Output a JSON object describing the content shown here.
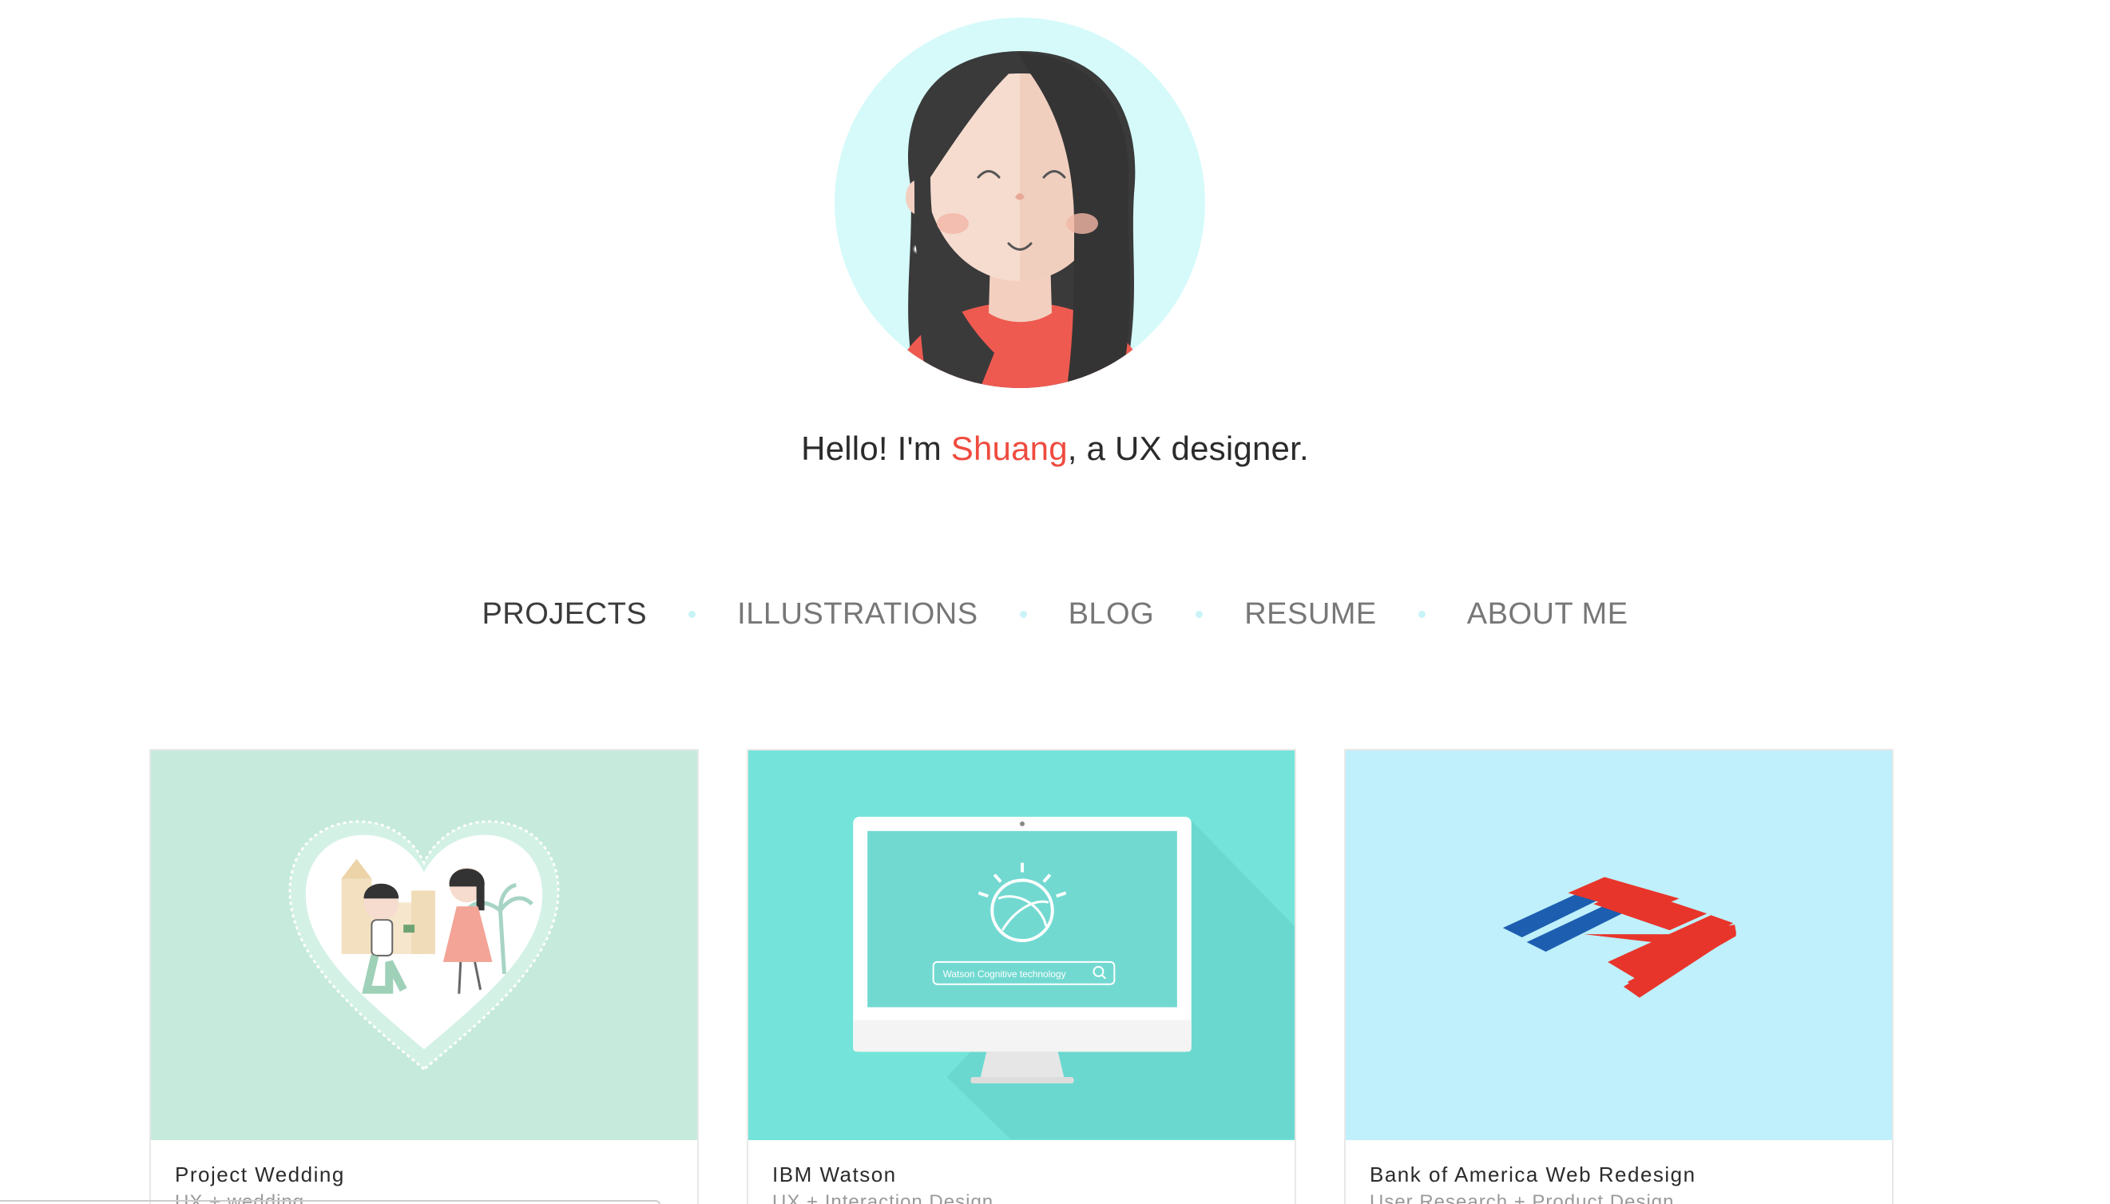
{
  "hero": {
    "greeting_prefix": "Hello! I'm ",
    "name": "Shuang",
    "greeting_suffix": ", a UX designer.",
    "avatar_icon": "girl-avatar-icon"
  },
  "nav": {
    "items": [
      {
        "label": "PROJECTS",
        "active": true
      },
      {
        "label": "ILLUSTRATIONS",
        "active": false
      },
      {
        "label": "BLOG",
        "active": false
      },
      {
        "label": "RESUME",
        "active": false
      },
      {
        "label": "ABOUT ME",
        "active": false
      }
    ]
  },
  "projects": [
    {
      "title": "Project Wedding",
      "subtitle": "UX + wedding",
      "bg": "#c6eadc"
    },
    {
      "title": "IBM Watson",
      "subtitle": "UX + Interaction Design",
      "bg": "#74e4da",
      "search_text": "Watson Cognitive technology"
    },
    {
      "title": "Bank of America Web Redesign",
      "subtitle": "User Research + Product Design",
      "bg": "#bff0fb"
    }
  ],
  "colors": {
    "accent": "#ef4b3f",
    "text": "#2b2b2b",
    "nav_inactive": "#777777",
    "avatar_bg": "#d6fafa"
  }
}
